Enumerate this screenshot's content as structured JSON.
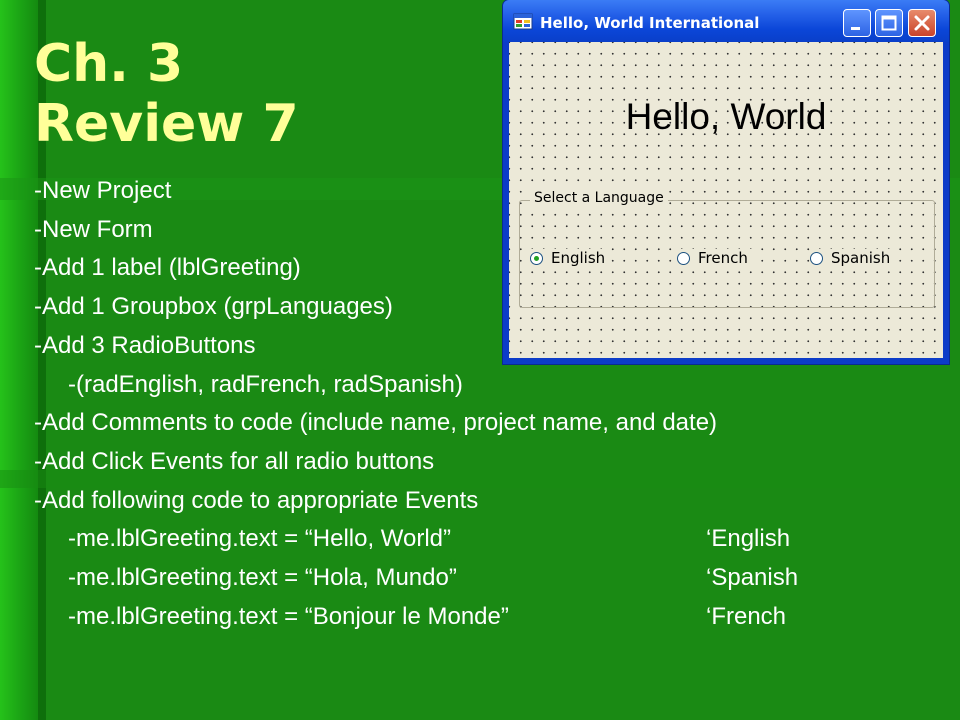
{
  "slide": {
    "title_line1": "Ch. 3",
    "title_line2": "Review 7",
    "bullets": [
      "-New Project",
      "-New Form",
      "-Add 1 label (lblGreeting)",
      "-Add 1 Groupbox (grpLanguages)",
      "-Add 3 RadioButtons",
      "-(radEnglish, radFrench, radSpanish)",
      "-Add Comments to code (include name, project name, and date)",
      "-Add Click Events for all radio buttons",
      "-Add following code to appropriate Events"
    ],
    "code_lines": [
      {
        "code": "-me.lblGreeting.text = “Hello, World”",
        "comment": "‘English"
      },
      {
        "code": "-me.lblGreeting.text = “Hola, Mundo”",
        "comment": "‘Spanish"
      },
      {
        "code": "-me.lblGreeting.text = “Bonjour le Monde”",
        "comment": "‘French"
      }
    ]
  },
  "window": {
    "title": "Hello, World International",
    "greeting": "Hello, World",
    "group_label": "Select a Language",
    "radios": [
      {
        "label": "English",
        "checked": true
      },
      {
        "label": "French",
        "checked": false
      },
      {
        "label": "Spanish",
        "checked": false
      }
    ]
  },
  "colors": {
    "background": "#1a8a14",
    "title_text": "#ffff99",
    "body_text": "#ffffff",
    "titlebar": "#0b46d8"
  }
}
